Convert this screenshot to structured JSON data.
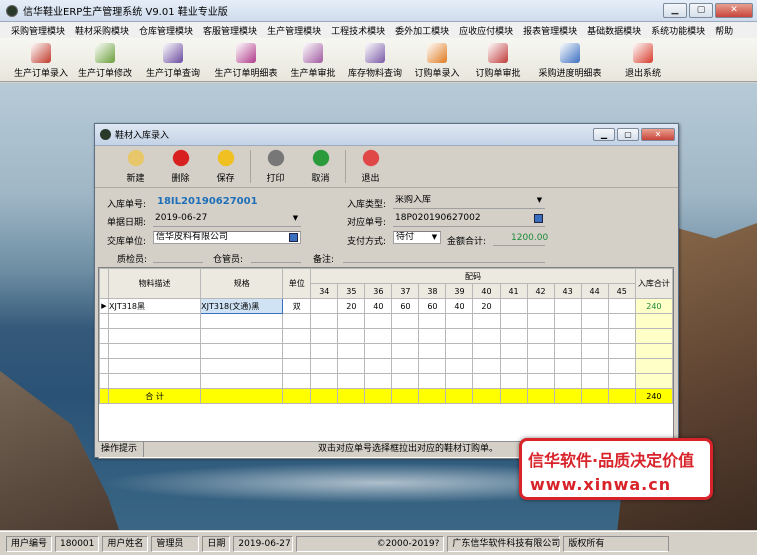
{
  "window": {
    "title": "信华鞋业ERP生产管理系统  V9.01  鞋业专业版"
  },
  "menu": [
    "采购管理模块",
    "鞋材采购模块",
    "仓库管理模块",
    "客服管理模块",
    "生产管理模块",
    "工程技术模块",
    "委外加工模块",
    "应收应付模块",
    "报表管理模块",
    "基础数据模块",
    "系统功能模块",
    "帮助"
  ],
  "toolbar": [
    {
      "label": "生产订单录入",
      "icon": "pdf-icon",
      "color": "#c0392b"
    },
    {
      "label": "生产订单修改",
      "icon": "edit-doc-icon",
      "color": "#6a9f3a"
    },
    {
      "label": "生产订单查询",
      "icon": "query-doc-icon",
      "color": "#6a4aa0"
    },
    {
      "label": "生产订单明细表",
      "icon": "detail-doc-icon",
      "color": "#b03a8a"
    },
    {
      "label": "生产单审批",
      "icon": "approve-doc-icon",
      "color": "#a05aa0"
    },
    {
      "label": "库存物料查询",
      "icon": "stock-query-icon",
      "color": "#7a5aa8"
    },
    {
      "label": "订购单录入",
      "icon": "order-entry-icon",
      "color": "#e07a20"
    },
    {
      "label": "订购单审批",
      "icon": "order-approve-icon",
      "color": "#c03a3a"
    },
    {
      "label": "采购进度明细表",
      "icon": "progress-report-icon",
      "color": "#3a6fc0"
    },
    {
      "label": "退出系统",
      "icon": "exit-icon",
      "color": "#d83a2a"
    }
  ],
  "child": {
    "title": "鞋材入库录入",
    "tools": [
      {
        "label": "新建",
        "icon": "new-doc-icon",
        "color": "#e8c66a"
      },
      {
        "label": "删除",
        "icon": "delete-x-icon",
        "color": "#d82020"
      },
      {
        "label": "保存",
        "icon": "save-disk-icon",
        "color": "#f0c020"
      },
      {
        "label": "打印",
        "icon": "printer-icon",
        "color": "#777777"
      },
      {
        "label": "取消",
        "icon": "refresh-cancel-icon",
        "color": "#2a9a3a"
      },
      {
        "label": "退出",
        "icon": "exit-icon",
        "color": "#e04848"
      }
    ],
    "form": {
      "no_label": "入库单号:",
      "no_value": "18IL20190627001",
      "date_label": "单据日期:",
      "date_value": "2019-06-27",
      "supplier_label": "交库单位:",
      "supplier_value": "信华皮料有限公司",
      "inspector_label": "质检员:",
      "keeper_label": "仓管员:",
      "remark_label": "备注:",
      "type_label": "入库类型:",
      "type_value": "采购入库",
      "ref_label": "对应单号:",
      "ref_value": "18P020190627002",
      "pay_label": "支付方式:",
      "pay_value": "待付",
      "amount_label": "金额合计:",
      "amount_value": "1200.00"
    },
    "grid": {
      "headers": {
        "desc": "物料描述",
        "spec": "规格",
        "unit": "单位",
        "size": "配码",
        "total": "入库合计"
      },
      "sizes": [
        "34",
        "35",
        "36",
        "37",
        "38",
        "39",
        "40",
        "41",
        "42",
        "43",
        "44",
        "45"
      ],
      "rows": [
        {
          "desc": "XJT318黑",
          "spec": "XJT318(文通)黑",
          "unit": "双",
          "qty": [
            "",
            "20",
            "40",
            "60",
            "60",
            "40",
            "20",
            "",
            "",
            "",
            "",
            ""
          ],
          "total": "240"
        }
      ],
      "sum": {
        "label": "合  计",
        "total": "240"
      },
      "hint_label": "操作提示",
      "hint_text": "双击对应单号选择框拉出对应的鞋材订购单。"
    }
  },
  "status": {
    "user_no_label": "用户编号",
    "user_no": "180001",
    "user_name_label": "用户姓名",
    "user_name": "管理员",
    "date_label": "日期",
    "date": "2019-06-27",
    "copyright": "©2000-2019?",
    "company": "广东信华软件科技有限公司",
    "rights": "版权所有"
  },
  "promo": {
    "line1": "信华软件·品质决定价值",
    "line2": "www.xinwa.cn"
  }
}
